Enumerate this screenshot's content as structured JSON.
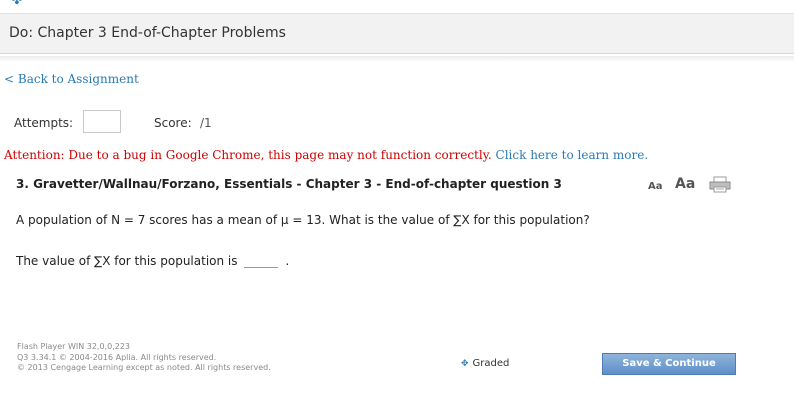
{
  "header": {
    "title": "Do: Chapter 3 End-of-Chapter Problems"
  },
  "nav": {
    "back_link": "< Back to Assignment"
  },
  "status": {
    "attempts_label": "Attempts:",
    "score_label": "Score:",
    "score_value": "/1"
  },
  "notice": {
    "warning": "Attention: Due to a bug in Google Chrome, this page may not function correctly.",
    "link": "Click here to learn more."
  },
  "question": {
    "title": "3. Gravetter/Wallnau/Forzano, Essentials - Chapter 3 - End-of-chapter question 3",
    "text": "A population of N = 7 scores has a mean of μ = 13. What is the value of ∑X for this population?",
    "answer_prefix": "The value of ∑X for this population is",
    "answer_suffix": "."
  },
  "tools": {
    "font_small": "Aa",
    "font_large": "Aa",
    "print_icon": "print-icon"
  },
  "footer": {
    "flash": "Flash Player WIN 32,0,0,223",
    "version": "Q3 3.34.1 © 2004-2016 Aplia. All rights reserved.",
    "copyright": "© 2013 Cengage Learning except as noted. All rights reserved.",
    "graded_label": "Graded",
    "save_button": "Save & Continue"
  },
  "colors": {
    "link": "#2a7ab8",
    "warning": "#cc0000",
    "button": "#6f9ccf"
  }
}
